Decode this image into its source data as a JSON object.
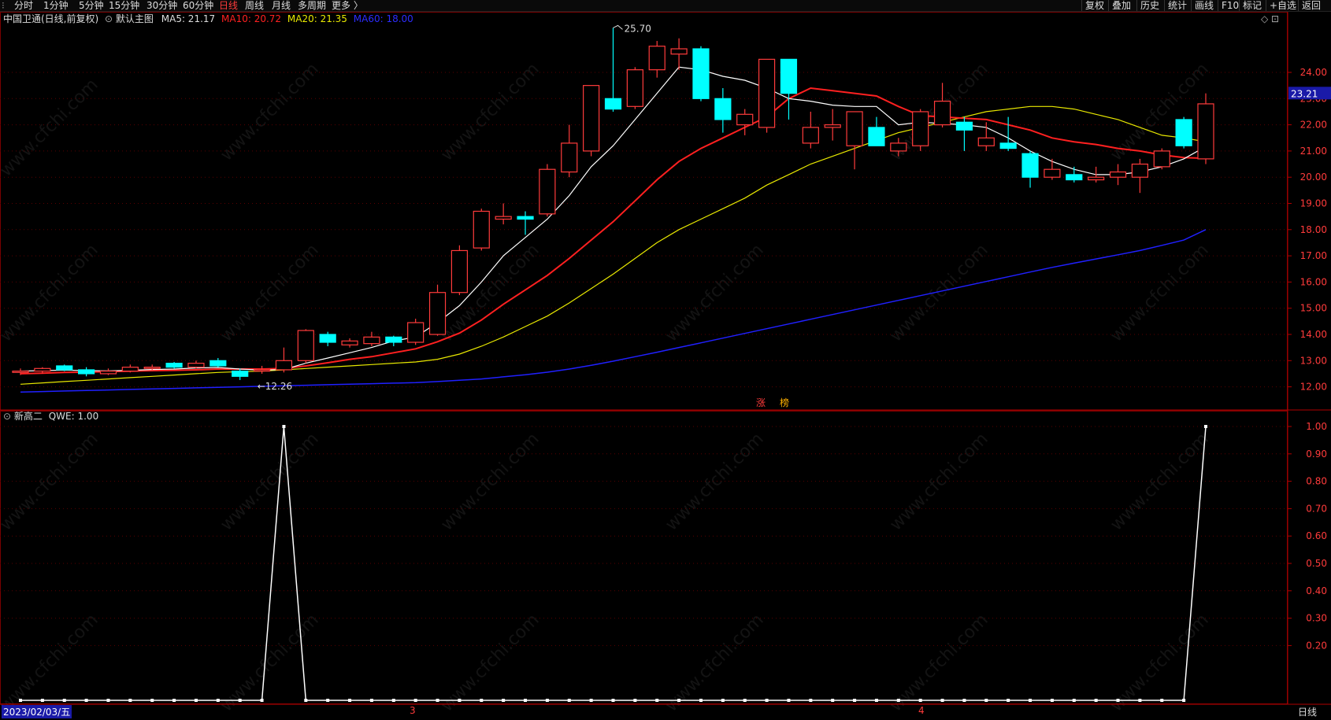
{
  "toolbar": {
    "periods": [
      "分时",
      "1分钟",
      "5分钟",
      "15分钟",
      "30分钟",
      "60分钟",
      "日线",
      "周线",
      "月线",
      "多周期",
      "更多 〉"
    ],
    "active_period": "日线",
    "right_buttons": [
      "复权",
      "叠加",
      "历史",
      "统计",
      "画线",
      "F10",
      "标记",
      "+自选",
      "返回"
    ]
  },
  "main_legend": {
    "stock": "中国卫通(日线,前复权)",
    "template": "默认主图",
    "ma5": "MA5: 21.17",
    "ma10": "MA10: 20.72",
    "ma20": "MA20: 21.35",
    "ma60": "MA60: 18.00"
  },
  "sub_legend": {
    "indicator": "新高二",
    "value": "QWE: 1.00"
  },
  "annotations": {
    "high": "25.70",
    "low": "12.26",
    "tags": [
      "涨",
      "榜"
    ]
  },
  "price_axis": {
    "ticks": [
      "24.00",
      "23.00",
      "22.00",
      "21.00",
      "20.00",
      "19.00",
      "18.00",
      "17.00",
      "16.00",
      "15.00",
      "14.00",
      "13.00",
      "12.00"
    ],
    "current_price": "23.21"
  },
  "sub_axis": {
    "ticks": [
      "1.00",
      "0.90",
      "0.80",
      "0.70",
      "0.60",
      "0.50",
      "0.40",
      "0.30",
      "0.20"
    ]
  },
  "date_axis": {
    "cursor_date": "2023/02/03/五",
    "markers": [
      "3",
      "4"
    ],
    "period_label": "日线"
  },
  "watermark": "www.cfchi.com",
  "colors": {
    "up": "#ff3b3b",
    "down": "#00ffff",
    "ma5": "#ffffff",
    "ma10": "#ff2020",
    "ma20": "#e8e800",
    "ma60": "#2020ff",
    "grid": "#7a0000"
  },
  "chart_data": {
    "type": "candlestick",
    "ylim": [
      11.6,
      25.9
    ],
    "candles": [
      [
        12.55,
        12.7,
        12.45,
        12.6
      ],
      [
        12.6,
        12.75,
        12.5,
        12.7
      ],
      [
        12.8,
        12.85,
        12.6,
        12.65
      ],
      [
        12.65,
        12.75,
        12.4,
        12.5
      ],
      [
        12.5,
        12.7,
        12.45,
        12.6
      ],
      [
        12.6,
        12.85,
        12.55,
        12.75
      ],
      [
        12.7,
        12.85,
        12.6,
        12.75
      ],
      [
        12.9,
        12.95,
        12.7,
        12.75
      ],
      [
        12.75,
        13.0,
        12.7,
        12.9
      ],
      [
        13.0,
        13.1,
        12.75,
        12.8
      ],
      [
        12.6,
        12.7,
        12.26,
        12.4
      ],
      [
        12.6,
        12.8,
        12.5,
        12.65
      ],
      [
        12.65,
        13.5,
        12.55,
        13.0
      ],
      [
        13.0,
        14.2,
        12.9,
        14.15
      ],
      [
        14.0,
        14.1,
        13.55,
        13.7
      ],
      [
        13.6,
        13.85,
        13.5,
        13.75
      ],
      [
        13.65,
        14.1,
        13.55,
        13.9
      ],
      [
        13.9,
        13.95,
        13.55,
        13.7
      ],
      [
        13.7,
        14.6,
        13.6,
        14.45
      ],
      [
        14.0,
        15.9,
        13.95,
        15.6
      ],
      [
        15.6,
        17.4,
        15.5,
        17.2
      ],
      [
        17.3,
        18.8,
        17.2,
        18.7
      ],
      [
        18.4,
        19.0,
        18.2,
        18.5
      ],
      [
        18.5,
        18.7,
        17.8,
        18.4
      ],
      [
        18.6,
        20.5,
        18.5,
        20.3
      ],
      [
        20.2,
        22.0,
        20.0,
        21.3
      ],
      [
        21.0,
        23.5,
        20.8,
        23.5
      ],
      [
        23.0,
        25.7,
        22.5,
        22.6
      ],
      [
        22.7,
        24.2,
        22.6,
        24.1
      ],
      [
        24.1,
        25.2,
        23.8,
        25.0
      ],
      [
        24.7,
        25.3,
        24.1,
        24.9
      ],
      [
        24.9,
        25.0,
        22.9,
        23.0
      ],
      [
        23.0,
        23.4,
        21.7,
        22.2
      ],
      [
        22.0,
        22.6,
        21.6,
        22.4
      ],
      [
        21.9,
        24.5,
        21.7,
        24.5
      ],
      [
        24.5,
        24.5,
        22.2,
        23.2
      ],
      [
        21.3,
        22.5,
        21.1,
        21.9
      ],
      [
        21.9,
        22.6,
        21.4,
        22.0
      ],
      [
        21.2,
        22.5,
        20.3,
        22.5
      ],
      [
        21.9,
        22.3,
        21.2,
        21.2
      ],
      [
        21.0,
        21.5,
        20.8,
        21.3
      ],
      [
        21.2,
        22.6,
        21.0,
        22.5
      ],
      [
        22.0,
        23.6,
        21.9,
        22.9
      ],
      [
        22.1,
        22.3,
        21.0,
        21.8
      ],
      [
        21.2,
        22.1,
        21.0,
        21.5
      ],
      [
        21.3,
        22.3,
        21.0,
        21.1
      ],
      [
        20.9,
        21.0,
        19.6,
        20.0
      ],
      [
        20.0,
        20.7,
        19.9,
        20.3
      ],
      [
        20.1,
        20.4,
        19.8,
        19.9
      ],
      [
        19.9,
        20.4,
        19.8,
        20.0
      ],
      [
        20.0,
        20.5,
        19.7,
        20.2
      ],
      [
        20.0,
        20.7,
        19.4,
        20.5
      ],
      [
        20.4,
        21.1,
        20.3,
        21.0
      ],
      [
        22.2,
        22.3,
        21.1,
        21.2
      ],
      [
        20.7,
        23.2,
        20.5,
        22.8
      ]
    ],
    "ma5": [
      12.6,
      12.62,
      12.64,
      12.62,
      12.61,
      12.63,
      12.66,
      12.68,
      12.72,
      12.74,
      12.68,
      12.64,
      12.66,
      12.9,
      13.1,
      13.3,
      13.5,
      13.75,
      13.9,
      14.45,
      15.1,
      16.0,
      17.0,
      17.7,
      18.4,
      19.3,
      20.4,
      21.2,
      22.2,
      23.2,
      24.2,
      24.1,
      23.85,
      23.7,
      23.4,
      23.0,
      22.9,
      22.75,
      22.7,
      22.7,
      22.0,
      22.1,
      22.05,
      22.0,
      21.9,
      21.5,
      21.0,
      20.6,
      20.3,
      20.1,
      20.1,
      20.2,
      20.4,
      20.7,
      21.17
    ],
    "ma10": [
      12.5,
      12.52,
      12.55,
      12.56,
      12.58,
      12.6,
      12.62,
      12.63,
      12.65,
      12.68,
      12.68,
      12.68,
      12.7,
      12.8,
      12.92,
      13.05,
      13.15,
      13.3,
      13.45,
      13.72,
      14.05,
      14.55,
      15.15,
      15.7,
      16.25,
      16.9,
      17.6,
      18.3,
      19.1,
      19.9,
      20.6,
      21.1,
      21.5,
      21.9,
      22.3,
      23.0,
      23.4,
      23.3,
      23.2,
      23.1,
      22.7,
      22.35,
      22.3,
      22.25,
      22.2,
      22.0,
      21.8,
      21.5,
      21.35,
      21.25,
      21.1,
      21.0,
      20.85,
      20.75,
      20.72
    ],
    "ma20": [
      12.1,
      12.15,
      12.2,
      12.25,
      12.3,
      12.35,
      12.4,
      12.45,
      12.5,
      12.55,
      12.58,
      12.6,
      12.65,
      12.7,
      12.75,
      12.8,
      12.85,
      12.9,
      12.95,
      13.05,
      13.25,
      13.55,
      13.9,
      14.3,
      14.7,
      15.2,
      15.75,
      16.3,
      16.9,
      17.5,
      18.0,
      18.4,
      18.8,
      19.2,
      19.7,
      20.1,
      20.5,
      20.8,
      21.1,
      21.4,
      21.7,
      21.9,
      22.1,
      22.3,
      22.5,
      22.6,
      22.7,
      22.7,
      22.6,
      22.4,
      22.2,
      21.9,
      21.6,
      21.5,
      21.35
    ],
    "ma60": [
      11.8,
      11.82,
      11.84,
      11.86,
      11.88,
      11.9,
      11.92,
      11.94,
      11.96,
      11.98,
      12.0,
      12.02,
      12.04,
      12.06,
      12.08,
      12.1,
      12.12,
      12.14,
      12.16,
      12.2,
      12.25,
      12.3,
      12.38,
      12.46,
      12.56,
      12.68,
      12.82,
      12.98,
      13.15,
      13.32,
      13.5,
      13.68,
      13.86,
      14.04,
      14.22,
      14.4,
      14.58,
      14.76,
      14.94,
      15.12,
      15.3,
      15.48,
      15.66,
      15.84,
      16.02,
      16.2,
      16.38,
      16.56,
      16.72,
      16.88,
      17.04,
      17.2,
      17.4,
      17.6,
      18.0
    ],
    "qwe": [
      0,
      0,
      0,
      0,
      0,
      0,
      0,
      0,
      0,
      0,
      0,
      0,
      1,
      0,
      0,
      0,
      0,
      0,
      0,
      0,
      0,
      0,
      0,
      0,
      0,
      0,
      0,
      0,
      0,
      0,
      0,
      0,
      0,
      0,
      0,
      0,
      0,
      0,
      0,
      0,
      0,
      0,
      0,
      0,
      0,
      0,
      0,
      0,
      0,
      0,
      0,
      0,
      0,
      0,
      1
    ]
  }
}
